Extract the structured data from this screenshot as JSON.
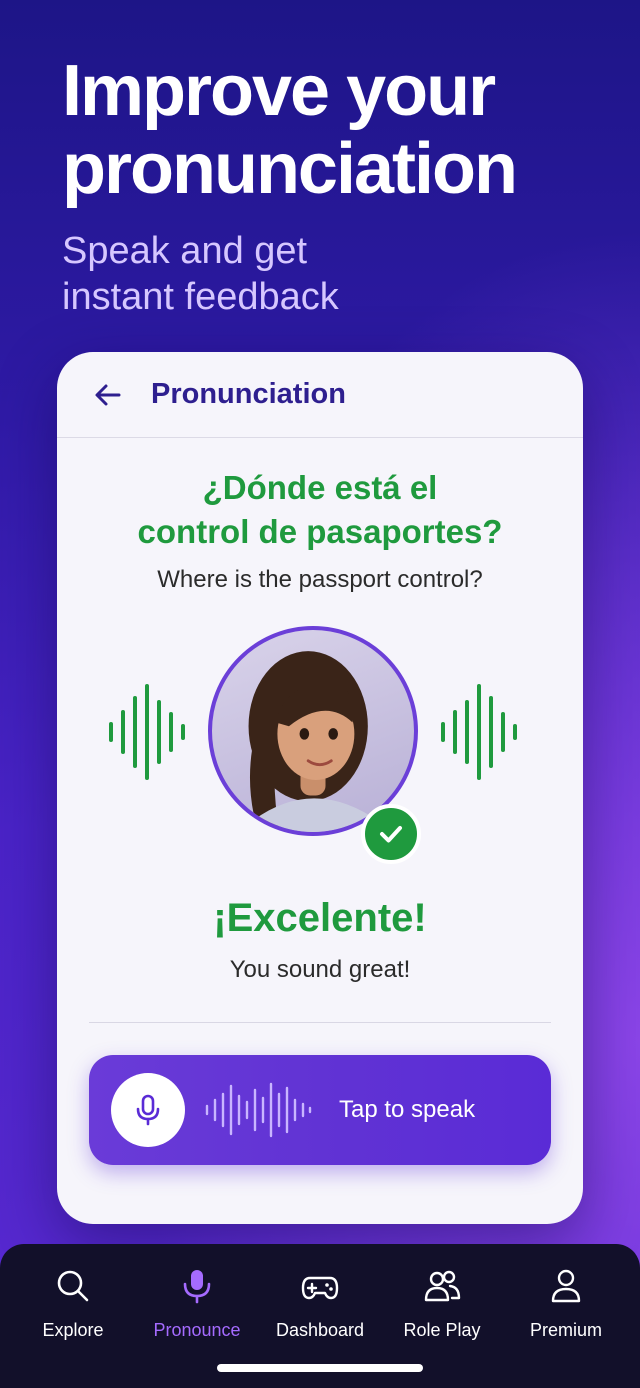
{
  "hero": {
    "title": "Improve your pronunciation",
    "subtitle_line1": "Speak and get",
    "subtitle_line2": "instant feedback"
  },
  "card": {
    "header_title": "Pronunciation",
    "phrase_line1": "¿Dónde está el",
    "phrase_line2": "control de pasaportes?",
    "translation": "Where is the passport control?",
    "result_title": "¡Excelente!",
    "result_subtitle": "You sound great!",
    "speak_button_label": "Tap to speak"
  },
  "nav": {
    "items": [
      {
        "label": "Explore",
        "icon": "search-icon"
      },
      {
        "label": "Pronounce",
        "icon": "microphone-icon",
        "active": true
      },
      {
        "label": "Dashboard",
        "icon": "gamepad-icon"
      },
      {
        "label": "Role Play",
        "icon": "users-icon"
      },
      {
        "label": "Premium",
        "icon": "user-icon"
      }
    ]
  },
  "colors": {
    "accent_purple": "#5a2bd6",
    "success_green": "#1f9a3e",
    "header_title": "#2e1f8f",
    "nav_active": "#a56bff",
    "nav_background": "#12102a"
  }
}
